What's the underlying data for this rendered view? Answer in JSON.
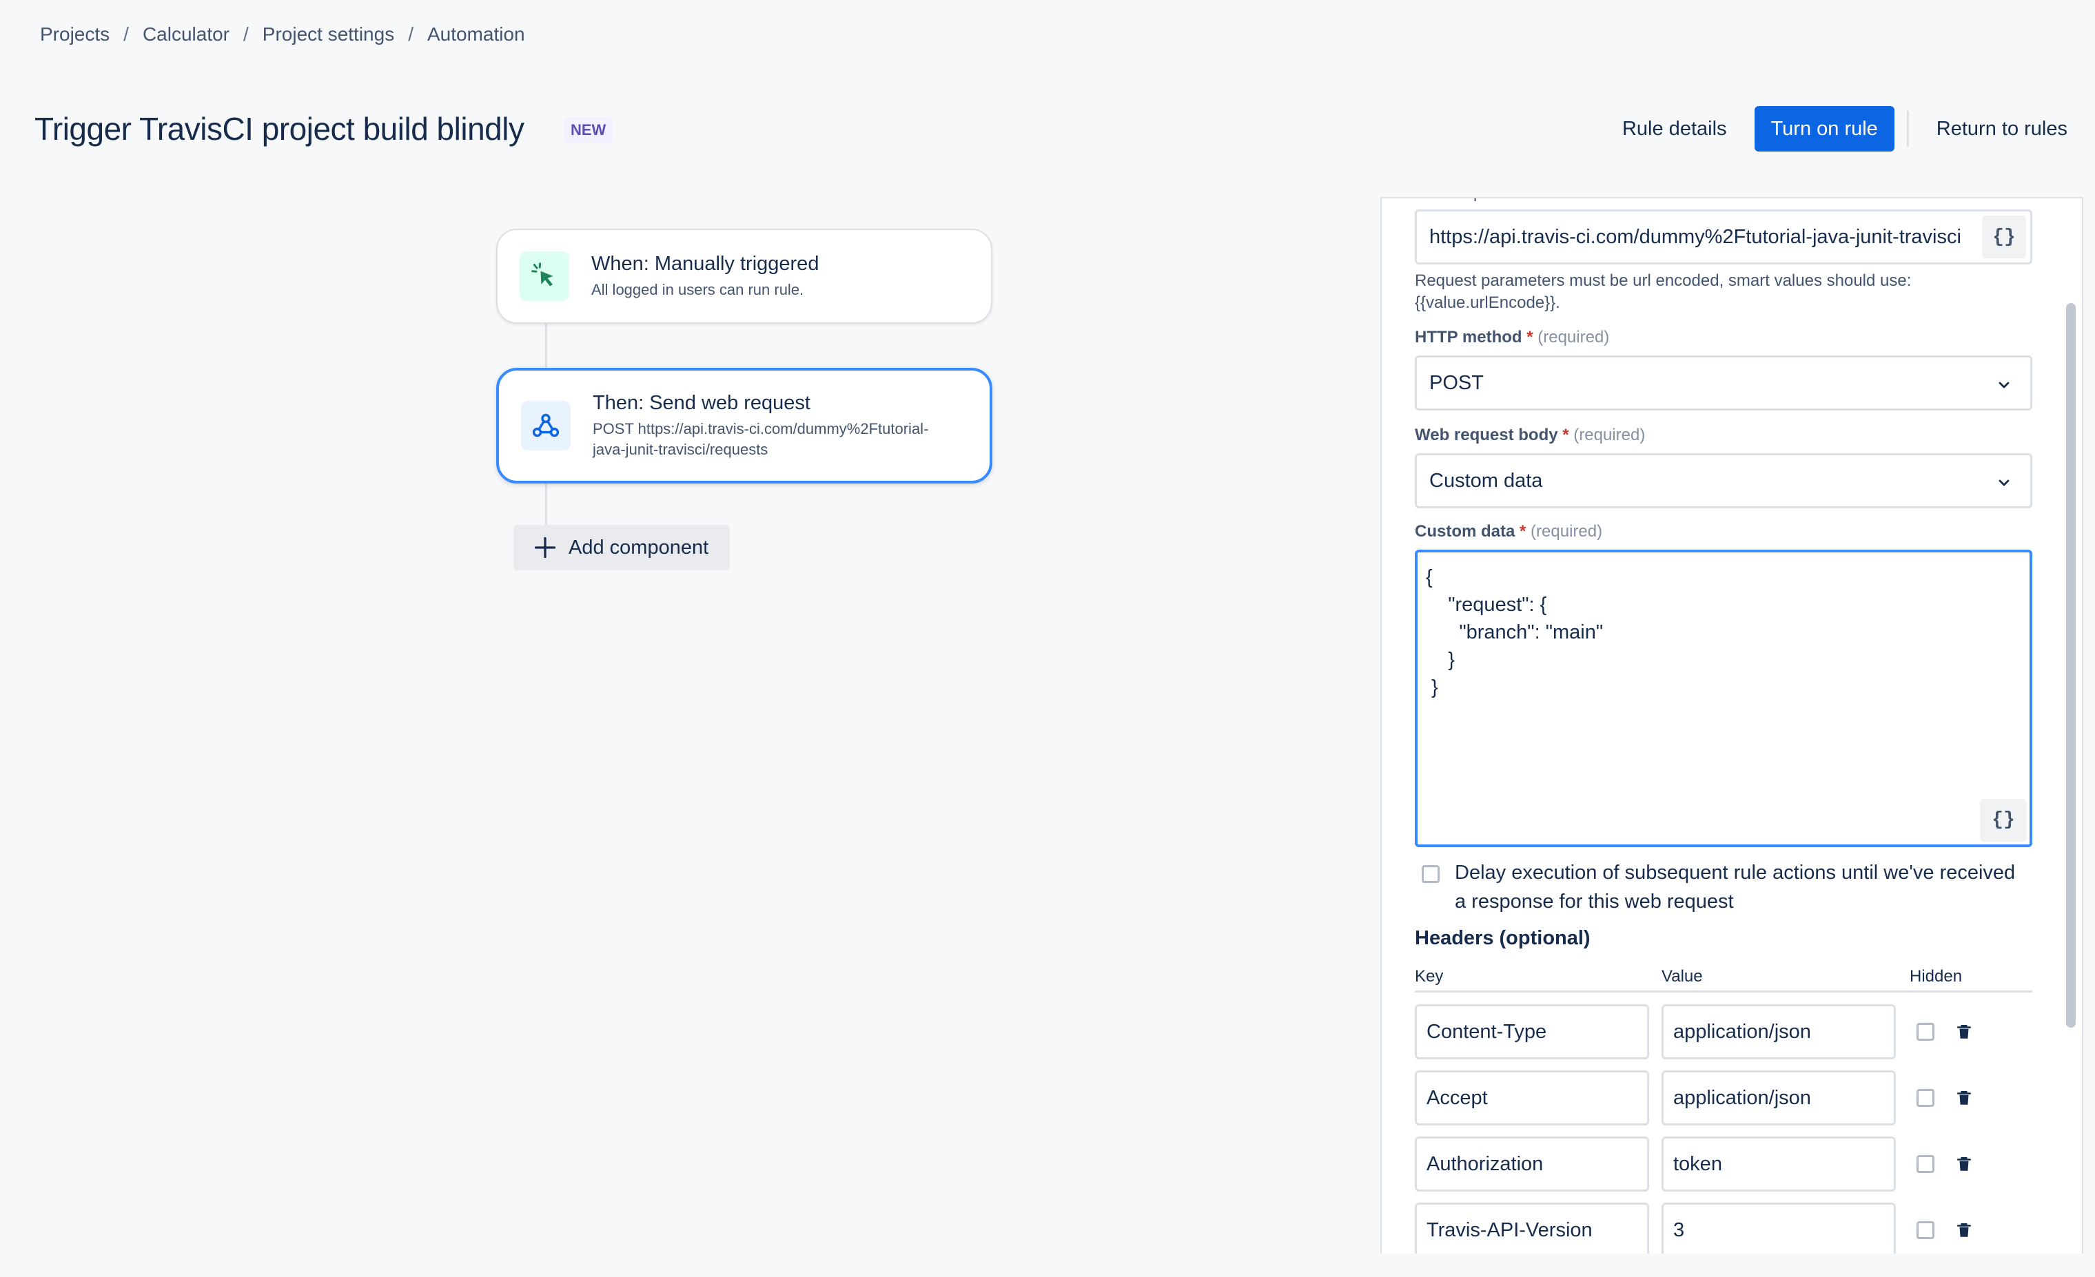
{
  "breadcrumb": {
    "items": [
      "Projects",
      "Calculator",
      "Project settings",
      "Automation"
    ],
    "separator": "/"
  },
  "header": {
    "title": "Trigger TravisCI project build blindly",
    "badge": "NEW",
    "rule_details": "Rule details",
    "turn_on": "Turn on rule",
    "return": "Return to rules"
  },
  "flow": {
    "trigger": {
      "title": "When: Manually triggered",
      "subtitle": "All logged in users can run rule.",
      "icon": "cursor-click-icon"
    },
    "action": {
      "title": "Then: Send web request",
      "subtitle_line1": "POST https://api.travis-ci.com/dummy%2Ftutorial-",
      "subtitle_line2": "java-junit-travisci/requests",
      "icon": "webhook-icon"
    },
    "add_component": "Add component"
  },
  "panel": {
    "url_label": "Web request URL",
    "url_value": "https://api.travis-ci.com/dummy%2Ftutorial-java-junit-travisci",
    "smart_value_button": "{}",
    "url_helper_line1": "Request parameters must be url encoded, smart values should use:",
    "url_helper_line2": "{{value.urlEncode}}.",
    "http_method": {
      "label": "HTTP method",
      "required": "(required)",
      "value": "POST"
    },
    "body": {
      "label": "Web request body",
      "required": "(required)",
      "value": "Custom data"
    },
    "custom_data": {
      "label": "Custom data",
      "required": "(required)",
      "lines": [
        "{",
        "    \"request\": {",
        "      \"branch\": \"main\"",
        "    }",
        " }"
      ]
    },
    "delay_text": "Delay execution of subsequent rule actions until we've received a response for this web request",
    "headers": {
      "title": "Headers (optional)",
      "columns": {
        "key": "Key",
        "value": "Value",
        "hidden": "Hidden"
      },
      "rows": [
        {
          "key": "Content-Type",
          "value": "application/json"
        },
        {
          "key": "Accept",
          "value": "application/json"
        },
        {
          "key": "Authorization",
          "value": "token"
        },
        {
          "key": "Travis-API-Version",
          "value": "3"
        }
      ]
    }
  },
  "colors": {
    "primary": "#0c66e4",
    "selected_border": "#388bff",
    "required": "#c9372c"
  }
}
